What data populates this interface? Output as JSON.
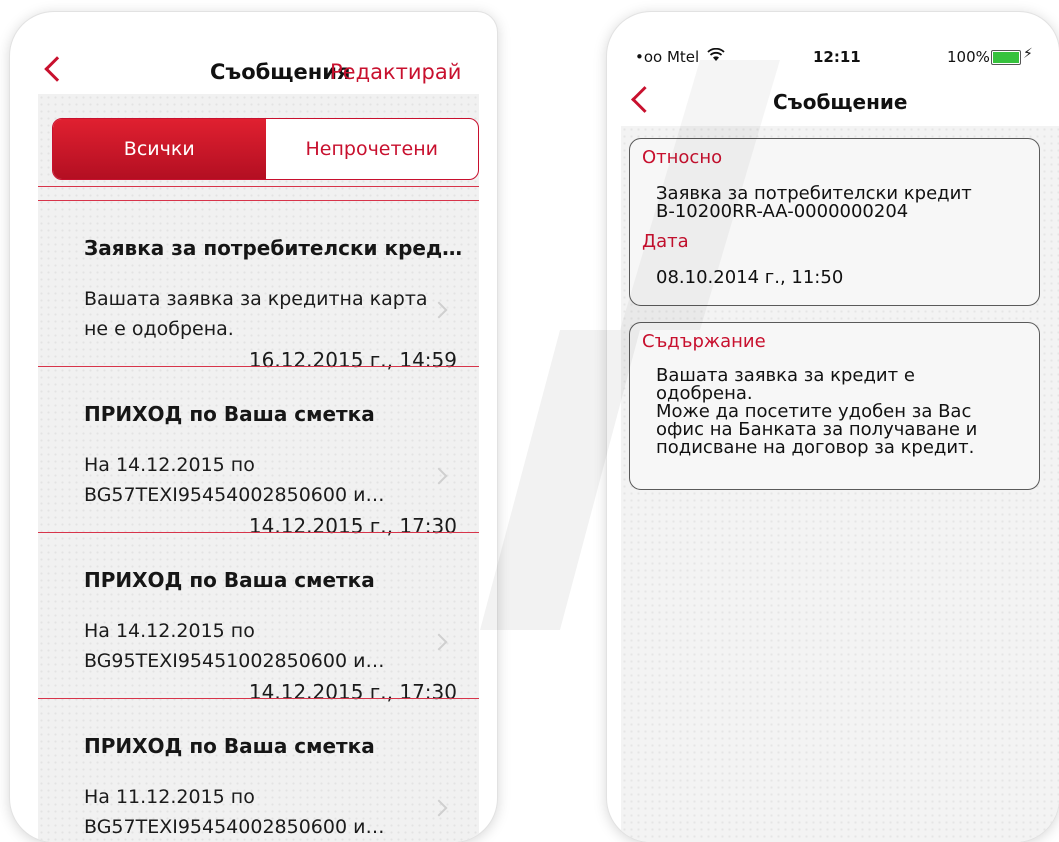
{
  "left_screen": {
    "title": "Съобщения",
    "edit_label": "Редактирай",
    "segments": [
      "Всички",
      "Непрочетени"
    ],
    "messages": [
      {
        "title": "Заявка за потребителски кред…",
        "preview": "Вашата заявка за кредитна карта\nне е одобрена.",
        "date": "16.12.2015 г., 14:59"
      },
      {
        "title": "ПРИХОД по Ваша сметка",
        "preview": "На 14.12.2015 по\nBG57TEXI95454002850600 и…",
        "date": "14.12.2015 г., 17:30"
      },
      {
        "title": "ПРИХОД по Ваша сметка",
        "preview": "На 14.12.2015 по\nBG95TEXI95451002850600 и…",
        "date": "14.12.2015 г., 17:30"
      },
      {
        "title": "ПРИХОД по Ваша сметка",
        "preview": "На 11.12.2015 по\nBG57TEXI95454002850600 и…",
        "date": ""
      }
    ]
  },
  "right_screen": {
    "status_bar": {
      "carrier": "•oo Mtel",
      "time": "12:11",
      "battery": "100%"
    },
    "title": "Съобщение",
    "cards": [
      {
        "label": "Относно",
        "value": "Заявка за потребителски кредит\nB-10200RR-AA-0000000204"
      },
      {
        "label": "Дата",
        "value": "08.10.2014 г., 11:50"
      },
      {
        "label": "Съдържание",
        "value": "Вашата заявка за кредит е\nодобрена.\n Може да  посетите удобен за Вас\nофис на Банката за получаване и\nподисване на договор за кредит."
      }
    ]
  },
  "colors": {
    "accent": "#c8102e",
    "background": "#f1f1f1"
  },
  "icons": [
    "back-chevron-icon",
    "wifi-icon",
    "battery-icon",
    "disclosure-chevron-icon"
  ]
}
